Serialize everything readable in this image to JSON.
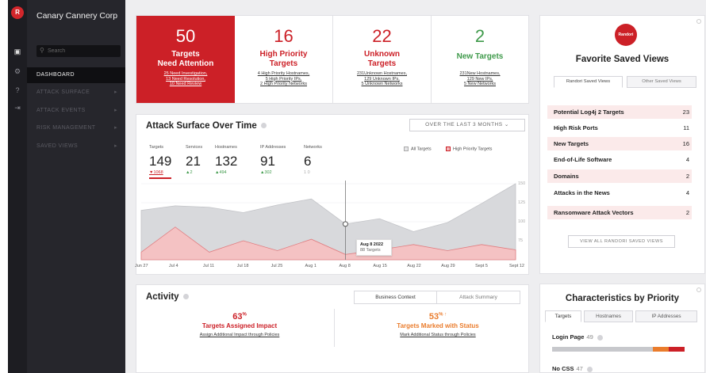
{
  "app": {
    "company": "Canary Cannery Corp",
    "logo_letter": "R",
    "search_placeholder": "Search"
  },
  "nav": [
    {
      "label": "DASHBOARD",
      "active": true
    },
    {
      "label": "ATTACK SURFACE",
      "chevron": "▸"
    },
    {
      "label": "ATTACK EVENTS",
      "chevron": "▸"
    },
    {
      "label": "RISK MANAGEMENT",
      "chevron": "▸"
    },
    {
      "label": "SAVED VIEWS",
      "chevron": "▸"
    }
  ],
  "rail_icons": [
    "grid-icon",
    "gear-icon",
    "help-icon",
    "logout-icon"
  ],
  "metrics": [
    {
      "num": "50",
      "label1": "Targets",
      "label2": "Need Attention",
      "subs": [
        "25 Need Investigation,",
        "13 Need Resolution,",
        "10 Need Review"
      ],
      "style": "red"
    },
    {
      "num": "16",
      "label1": "High Priority",
      "label2": "Targets",
      "subs": [
        "4 High Priority Hostnames,",
        "5 High Priority IPs,",
        "2 High Priority Networks"
      ],
      "style": "red-text"
    },
    {
      "num": "22",
      "label1": "Unknown",
      "label2": "Targets",
      "subs": [
        "231Unknown Hostnames,",
        "129 Unknown IPs,",
        "5 Unknown Networks"
      ],
      "style": "red-text"
    },
    {
      "num": "2",
      "label1": "New Targets",
      "label2": "",
      "subs": [
        "231New Hostnames,",
        "129 New IPs,",
        "5 New Networks"
      ],
      "style": "green-text"
    }
  ],
  "attack_surface": {
    "title": "Attack Surface Over Time",
    "range": "OVER THE LAST 3 MONTHS",
    "range_chevron": "⌄",
    "stats": [
      {
        "h": "Targets",
        "v": "149",
        "d": "▼1068"
      },
      {
        "h": "Services",
        "v": "21",
        "d": "▲2"
      },
      {
        "h": "Hostnames",
        "v": "132",
        "d": "▲494"
      },
      {
        "h": "IP Addresses",
        "v": "91",
        "d": "▲302"
      },
      {
        "h": "Networks",
        "v": "6",
        "d": "1 0"
      }
    ],
    "legend": [
      "All Targets",
      "High Priority Targets"
    ],
    "tooltip_date": "Aug 8 2022",
    "tooltip_val": "88 Targets"
  },
  "chart_data": {
    "type": "area",
    "x": [
      "Jun 27",
      "Jul 4",
      "Jul 11",
      "Jul 18",
      "Jul 25",
      "Aug 1",
      "Aug 8",
      "Aug 15",
      "Aug 22",
      "Aug 29",
      "Sept 5",
      "Sept 12"
    ],
    "y_ticks": [
      "150",
      "125",
      "100",
      "75"
    ],
    "ylim": [
      50,
      150
    ],
    "series": [
      {
        "name": "All Targets",
        "color": "#c8c9cd",
        "values": [
          115,
          121,
          119,
          112,
          122,
          130,
          97,
          104,
          87,
          99,
          124,
          150
        ]
      },
      {
        "name": "High Priority Targets",
        "color": "#f2b6b8",
        "values": [
          60,
          93,
          60,
          75,
          62,
          77,
          57,
          63,
          70,
          62,
          70,
          63
        ]
      }
    ]
  },
  "activity": {
    "title": "Activity",
    "tabs": [
      "Business Context",
      "Attack Summary"
    ],
    "blocks": [
      {
        "pct": "63",
        "unit": "%",
        "title": "Targets Assigned Impact",
        "link": "Assign Additional Impact through Policies",
        "color": "#cc2027"
      },
      {
        "pct": "53",
        "unit": "% ↑",
        "title": "Targets Marked with Status",
        "link": "Mark Additional Status through Policies",
        "color": "#ea7c2c"
      }
    ]
  },
  "favorites": {
    "logo": "Randori",
    "title": "Favorite Saved Views",
    "tabs": [
      "Randori Saved Views",
      "Other Saved Views"
    ],
    "rows": [
      {
        "label": "Potential Log4j 2 Targets",
        "count": "23"
      },
      {
        "label": "High Risk Ports",
        "count": "11"
      },
      {
        "label": "New Targets",
        "count": "16"
      },
      {
        "label": "End-of-Life Software",
        "count": "4"
      },
      {
        "label": "Domains",
        "count": "2"
      },
      {
        "label": "Attacks in the News",
        "count": "4"
      },
      {
        "label": "Ransomware Attack Vectors",
        "count": "2"
      }
    ],
    "view_all": "VIEW ALL RANDORI SAVED VIEWS"
  },
  "characteristics": {
    "title": "Characteristics by Priority",
    "tabs": [
      "Targets",
      "Hostnames",
      "IP Addresses"
    ],
    "items": [
      {
        "label": "Login Page",
        "count": "49",
        "grey": 0.76,
        "orange": 0.12,
        "red": 0.12
      },
      {
        "label": "No CSS",
        "count": "47"
      }
    ]
  }
}
